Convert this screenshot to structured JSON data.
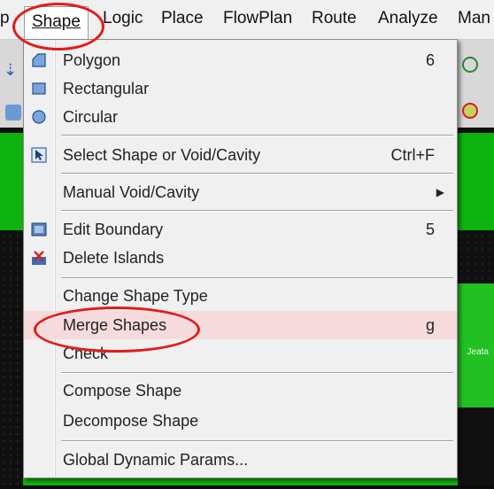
{
  "menubar": {
    "items": [
      {
        "label": "p"
      },
      {
        "label": "Shape",
        "active": true
      },
      {
        "label": "Logic"
      },
      {
        "label": "Place"
      },
      {
        "label": "FlowPlan"
      },
      {
        "label": "Route"
      },
      {
        "label": "Analyze"
      },
      {
        "label": "Man"
      }
    ]
  },
  "shape_menu": {
    "polygon": {
      "label": "Polygon",
      "shortcut": "6",
      "icon": "polygon-icon"
    },
    "rectangular": {
      "label": "Rectangular",
      "icon": "rectangle-icon"
    },
    "circular": {
      "label": "Circular",
      "icon": "circle-icon"
    },
    "select_shape": {
      "label": "Select Shape or Void/Cavity",
      "shortcut": "Ctrl+F",
      "icon": "select-cursor-icon"
    },
    "manual_void": {
      "label": "Manual Void/Cavity",
      "submenu": true
    },
    "edit_boundary": {
      "label": "Edit Boundary",
      "shortcut": "5",
      "icon": "edit-boundary-icon"
    },
    "delete_islands": {
      "label": "Delete Islands",
      "icon": "delete-islands-icon"
    },
    "change_shape_type": {
      "label": "Change Shape Type"
    },
    "merge_shapes": {
      "label": "Merge Shapes",
      "shortcut": "g",
      "highlighted": true
    },
    "check": {
      "label": "Check"
    },
    "compose_shape": {
      "label": "Compose Shape"
    },
    "decompose_shape": {
      "label": "Decompose Shape"
    },
    "global_dynamic_params": {
      "label": "Global Dynamic Params..."
    }
  },
  "background": {
    "right_text": "Jeata"
  },
  "colors": {
    "menu_bg": "#f0f0f0",
    "highlight": "#f6dbdd",
    "annotation": "#e11b1b",
    "canvas_green": "#0fb30f"
  }
}
